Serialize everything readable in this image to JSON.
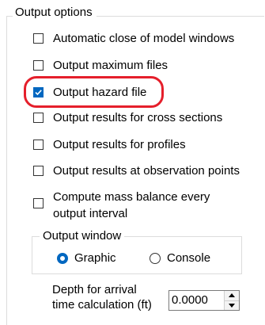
{
  "output_options": {
    "title": "Output options",
    "checkboxes": [
      {
        "label": "Automatic close of model windows",
        "checked": false
      },
      {
        "label": "Output maximum files",
        "checked": false
      },
      {
        "label": "Output hazard file",
        "checked": true
      },
      {
        "label": "Output results for cross sections",
        "checked": false
      },
      {
        "label": "Output results for profiles",
        "checked": false
      },
      {
        "label": "Output results at observation points",
        "checked": false
      },
      {
        "label_line1": "Compute mass balance every",
        "label_line2": "output interval",
        "checked": false
      }
    ],
    "output_window": {
      "title": "Output  window",
      "options": [
        {
          "label": "Graphic",
          "selected": true
        },
        {
          "label": "Console",
          "selected": false
        }
      ]
    },
    "depth": {
      "label_line1": "Depth for arrival",
      "label_line2": "time calculation (ft)",
      "value": "0.0000"
    }
  },
  "colors": {
    "accent": "#0067c0",
    "highlight": "#e51f2b"
  }
}
